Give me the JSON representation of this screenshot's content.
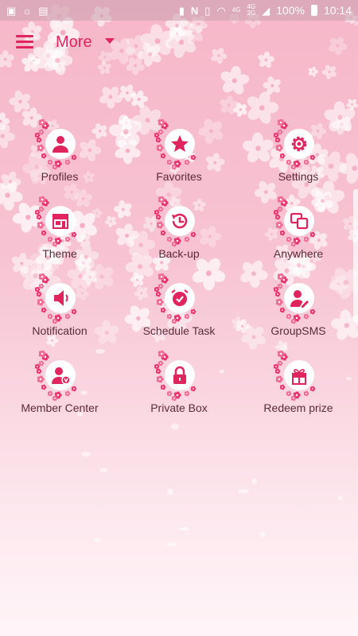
{
  "status_bar": {
    "network_labels": [
      "4G",
      "4G",
      "2G"
    ],
    "battery": "100%",
    "time": "10:14"
  },
  "app_bar": {
    "title": "More"
  },
  "tiles": [
    {
      "label": "Profiles",
      "icon": "person-icon"
    },
    {
      "label": "Favorites",
      "icon": "star-icon"
    },
    {
      "label": "Settings",
      "icon": "gear-icon"
    },
    {
      "label": "Theme",
      "icon": "store-icon"
    },
    {
      "label": "Back-up",
      "icon": "backup-clock-icon"
    },
    {
      "label": "Anywhere",
      "icon": "devices-icon"
    },
    {
      "label": "Notification",
      "icon": "speaker-icon"
    },
    {
      "label": "Schedule Task",
      "icon": "alarm-clock-icon"
    },
    {
      "label": "GroupSMS",
      "icon": "person-edit-icon"
    },
    {
      "label": "Member Center",
      "icon": "member-icon"
    },
    {
      "label": "Private Box",
      "icon": "lock-icon"
    },
    {
      "label": "Redeem prize",
      "icon": "gift-icon"
    }
  ],
  "colors": {
    "accent": "#e0245e",
    "label": "#5a2a3a"
  }
}
